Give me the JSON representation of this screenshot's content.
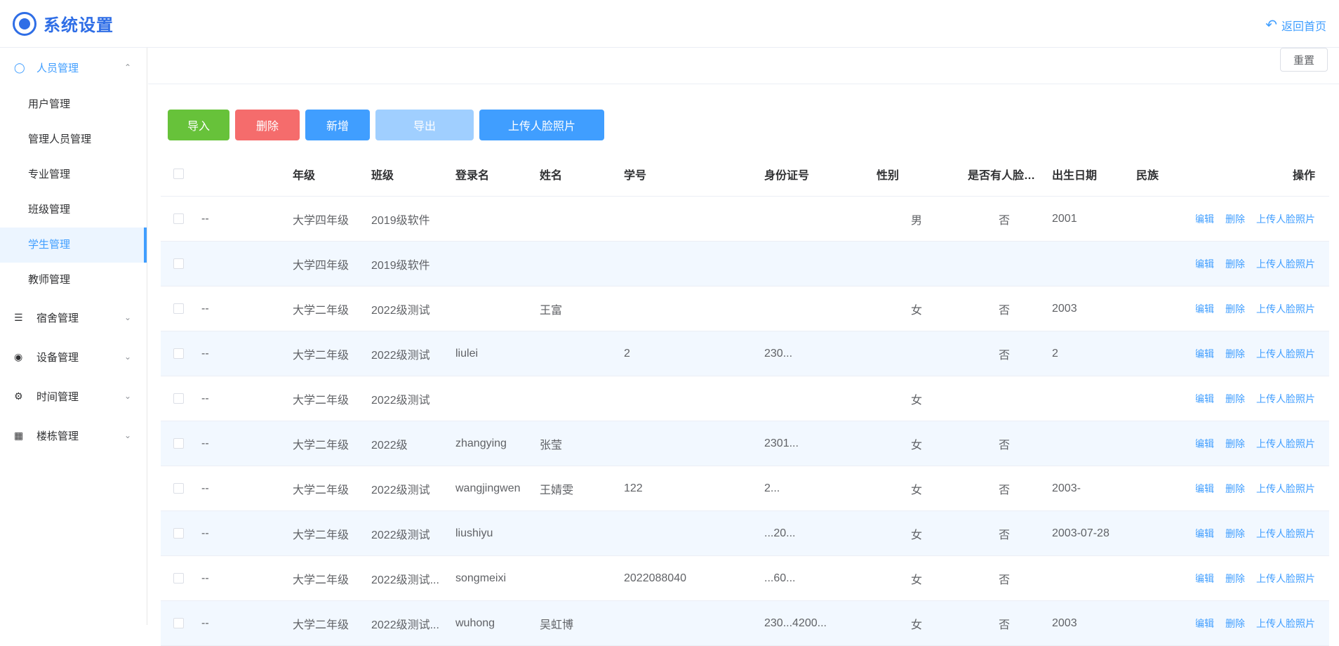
{
  "header": {
    "title": "系统设置",
    "back_home": "返回首页"
  },
  "sidebar": {
    "groups": [
      {
        "label": "人员管理",
        "icon": "user-icon",
        "expanded": true,
        "items": [
          "用户管理",
          "管理人员管理",
          "专业管理",
          "班级管理",
          "学生管理",
          "教师管理"
        ],
        "active_item": "学生管理"
      },
      {
        "label": "宿舍管理",
        "icon": "layers-icon"
      },
      {
        "label": "设备管理",
        "icon": "device-icon"
      },
      {
        "label": "时间管理",
        "icon": "gear-icon"
      },
      {
        "label": "楼栋管理",
        "icon": "building-icon"
      }
    ]
  },
  "filter": {
    "reset": "重置"
  },
  "toolbar": {
    "import": "导入",
    "delete": "删除",
    "add": "新增",
    "export": "导出",
    "upload_faces": "上传人脸照片"
  },
  "table": {
    "headers": [
      "",
      "",
      "年级",
      "班级",
      "登录名",
      "姓名",
      "学号",
      "身份证号",
      "性别",
      "是否有人脸照片",
      "出生日期",
      "民族",
      "操作"
    ],
    "ops": {
      "edit": "编辑",
      "delete": "删除",
      "upload": "上传人脸照片"
    },
    "rows": [
      {
        "dash": "--",
        "grade": "大学四年级",
        "klass": "2019级软件",
        "login": "",
        "name": "",
        "sno": "",
        "idno": "",
        "gender": "男",
        "face": "否",
        "birth": "2001",
        "nation": ""
      },
      {
        "dash": "",
        "grade": "大学四年级",
        "klass": "2019级软件",
        "login": "",
        "name": "",
        "sno": "",
        "idno": "",
        "gender": "",
        "face": "",
        "birth": "",
        "nation": ""
      },
      {
        "dash": "--",
        "grade": "大学二年级",
        "klass": "2022级测试",
        "login": "",
        "name": "王富",
        "sno": "",
        "idno": "",
        "gender": "女",
        "face": "否",
        "birth": "2003",
        "nation": ""
      },
      {
        "dash": "--",
        "grade": "大学二年级",
        "klass": "2022级测试",
        "login": "liulei",
        "name": "",
        "sno": "2",
        "idno": "230...",
        "gender": "",
        "face": "否",
        "birth": "2",
        "nation": ""
      },
      {
        "dash": "--",
        "grade": "大学二年级",
        "klass": "2022级测试",
        "login": "",
        "name": "",
        "sno": "",
        "idno": "",
        "gender": "女",
        "face": "",
        "birth": "",
        "nation": ""
      },
      {
        "dash": "--",
        "grade": "大学二年级",
        "klass": "2022级",
        "login": "zhangying",
        "name": "张莹",
        "sno": "",
        "idno": "2301...",
        "gender": "女",
        "face": "否",
        "birth": "",
        "nation": ""
      },
      {
        "dash": "--",
        "grade": "大学二年级",
        "klass": "2022级测试",
        "login": "wangjingwen",
        "name": "王婧雯",
        "sno": "122",
        "idno": "2...",
        "gender": "女",
        "face": "否",
        "birth": "2003-",
        "nation": ""
      },
      {
        "dash": "--",
        "grade": "大学二年级",
        "klass": "2022级测试",
        "login": "liushiyu",
        "name": "",
        "sno": "",
        "idno": "...20...",
        "gender": "女",
        "face": "否",
        "birth": "2003-07-28",
        "nation": ""
      },
      {
        "dash": "--",
        "grade": "大学二年级",
        "klass": "2022级测试...",
        "login": "songmeixi",
        "name": "",
        "sno": "2022088040",
        "idno": "...60...",
        "gender": "女",
        "face": "否",
        "birth": "",
        "nation": ""
      },
      {
        "dash": "--",
        "grade": "大学二年级",
        "klass": "2022级测试...",
        "login": "wuhong",
        "name": "吴虹博",
        "sno": "",
        "idno": "230...4200...",
        "gender": "女",
        "face": "否",
        "birth": "2003",
        "nation": ""
      }
    ]
  }
}
